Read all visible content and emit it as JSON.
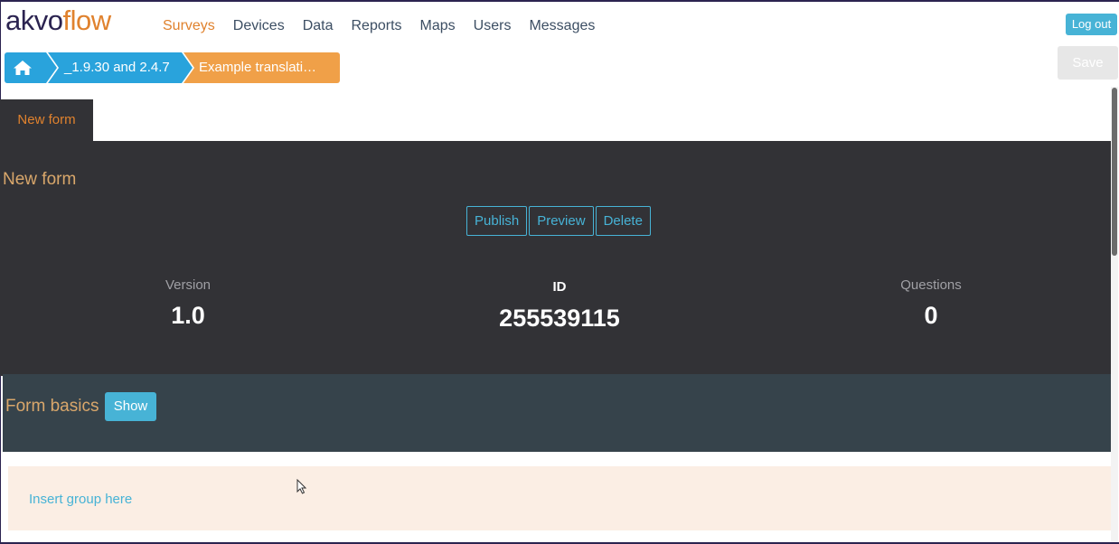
{
  "brand": {
    "part1": "akvo",
    "part2": "flow"
  },
  "nav": [
    {
      "label": "Surveys",
      "active": true
    },
    {
      "label": "Devices"
    },
    {
      "label": "Data"
    },
    {
      "label": "Reports"
    },
    {
      "label": "Maps"
    },
    {
      "label": "Users"
    },
    {
      "label": "Messages"
    }
  ],
  "header": {
    "logout_label": "Log out",
    "save_label": "Save"
  },
  "breadcrumb": {
    "home_icon": "home-icon",
    "survey": "_1.9.30 and 2.4.7",
    "form": "Example translati…"
  },
  "tab": {
    "label": "New form"
  },
  "form": {
    "title": "New form",
    "actions": {
      "publish": "Publish",
      "preview": "Preview",
      "delete": "Delete"
    },
    "stats": {
      "version": {
        "label": "Version",
        "value": "1.0"
      },
      "id": {
        "label": "ID",
        "value": "255539115"
      },
      "questions": {
        "label": "Questions",
        "value": "0"
      }
    }
  },
  "basics": {
    "title": "Form basics",
    "show_label": "Show"
  },
  "insert": {
    "label": "Insert group here"
  },
  "colors": {
    "brand_dark": "#2b2350",
    "accent": "#e0822e",
    "link": "#47b3d6",
    "panel": "#323236"
  }
}
